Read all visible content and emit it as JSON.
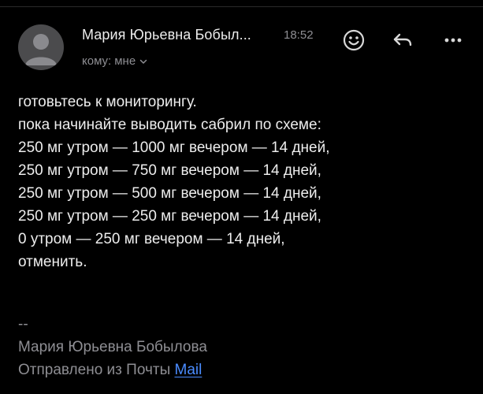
{
  "header": {
    "sender_name": "Мария Юрьевна Бобыл...",
    "time": "18:52",
    "recipient_prefix": "кому:",
    "recipient_value": "мне",
    "icons": {
      "avatar": "person-avatar",
      "emoji": "smiley-icon",
      "reply": "reply-arrow-icon",
      "more": "ellipsis-icon",
      "chevron": "chevron-down-icon"
    }
  },
  "body": {
    "lines": [
      "готовьтесь к мониторингу.",
      "пока начинайте выводить сабрил по схеме:",
      "250 мг утром — 1000 мг вечером — 14 дней,",
      "250 мг утром — 750 мг вечером — 14 дней,",
      "250 мг утром — 500 мг вечером — 14 дней,",
      "250 мг утром — 250 мг вечером — 14 дней,",
      "0 утром — 250 мг вечером — 14 дней,",
      "отменить."
    ]
  },
  "signature": {
    "separator": "--",
    "name": "Мария Юрьевна Бобылова",
    "sent_from_prefix": "Отправлено из Почты ",
    "link_text": "Mail"
  },
  "colors": {
    "background": "#000000",
    "text_primary": "#ededed",
    "text_secondary": "#8e8e93",
    "link": "#4a8cff",
    "avatar_bg": "#4b4b4d"
  }
}
